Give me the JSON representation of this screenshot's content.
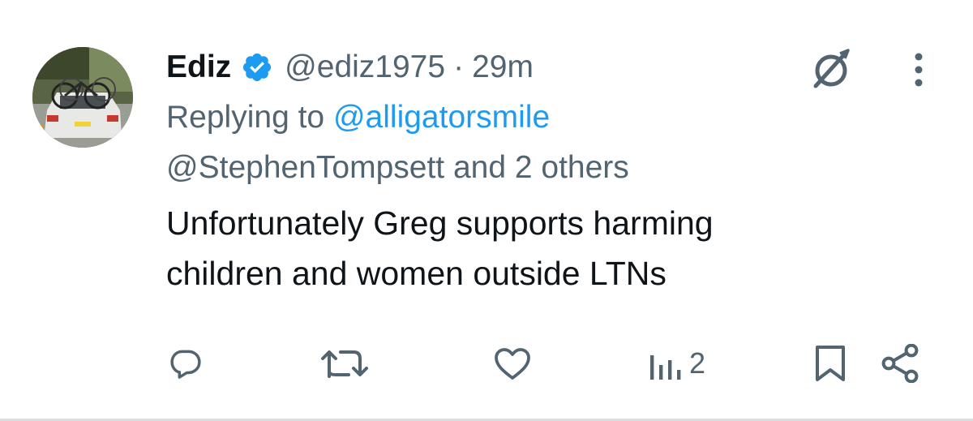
{
  "tweet": {
    "author_name": "Ediz",
    "handle": "@ediz1975",
    "separator": "·",
    "time": "29m",
    "replying_prefix": "Replying to",
    "reply_mention": "@alligatorsmile",
    "reply_second_line": "@StephenTompsett and 2 others",
    "text_line1": "Unfortunately Greg supports harming",
    "text_line2": "children and women outside LTNs"
  },
  "actions": {
    "views_count": "2"
  },
  "colors": {
    "accent": "#1d9bf0",
    "muted": "#536471",
    "text": "#0f1419",
    "icon": "#536471"
  },
  "icons": [
    "verified-badge-icon",
    "grok-icon",
    "more-options-icon",
    "reply-icon",
    "retweet-icon",
    "like-icon",
    "views-icon",
    "bookmark-icon",
    "share-icon"
  ]
}
